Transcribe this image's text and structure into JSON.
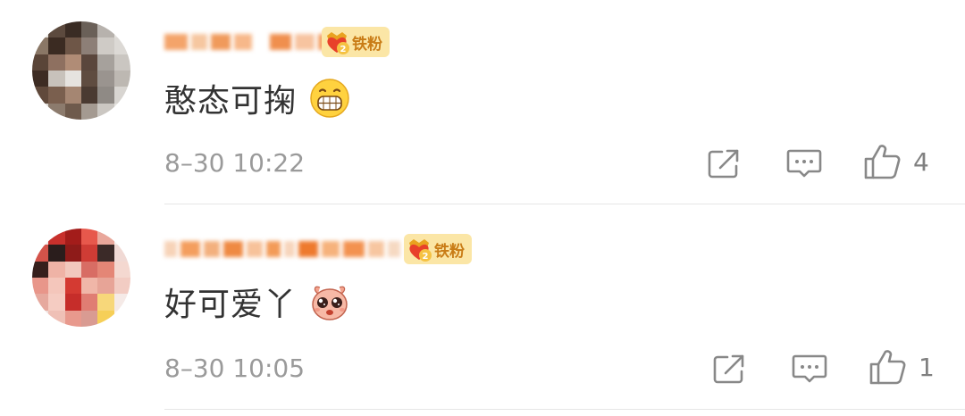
{
  "colors": {
    "badge_bg": "#fbe6a6",
    "badge_text": "#c97c16",
    "text_primary": "#333333",
    "text_secondary": "#9a9a9a",
    "divider": "#e6e6e6"
  },
  "comments": [
    {
      "avatar_icon": "pixelated-avatar",
      "username_hidden": true,
      "badge": {
        "icon": "heart-crown-icon",
        "level": "2",
        "label": "铁粉"
      },
      "text": "憨态可掬",
      "emoji": "grin-emoji",
      "time": "8–30 10:22",
      "actions": {
        "share_icon": "share-icon",
        "reply_icon": "reply-icon",
        "like_icon": "thumbs-up-icon",
        "like_count": "4"
      }
    },
    {
      "avatar_icon": "pixelated-avatar",
      "username_hidden": true,
      "badge": {
        "icon": "heart-crown-icon",
        "level": "2",
        "label": "铁粉"
      },
      "text": "好可爱丫",
      "emoji": "cute-face-emoji",
      "time": "8–30 10:05",
      "actions": {
        "share_icon": "share-icon",
        "reply_icon": "reply-icon",
        "like_icon": "thumbs-up-icon",
        "like_count": "1"
      }
    }
  ]
}
